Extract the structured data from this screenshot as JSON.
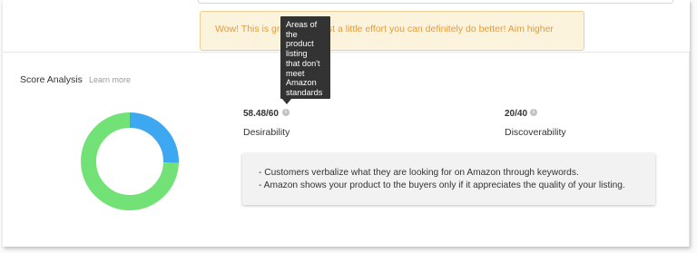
{
  "alert": {
    "text": "Wow! This is great! With just a little effort you can definitely do better! Aim higher"
  },
  "tooltip": {
    "lines": [
      "Areas of",
      "the",
      "product",
      "listing",
      "that don't",
      "meet",
      "Amazon",
      "standards"
    ]
  },
  "score_analysis": {
    "title": "Score Analysis",
    "learn_more": "Learn more"
  },
  "scores": [
    {
      "value": "58.48/60",
      "label": "Desirability"
    },
    {
      "value": "20/40",
      "label": "Discoverability"
    }
  ],
  "donut": {
    "segments": [
      {
        "name": "Desirability",
        "value": 58.48,
        "color": "#72e276"
      },
      {
        "name": "Discoverability",
        "value": 20,
        "color": "#3da7f2"
      }
    ]
  },
  "notes": [
    "- Customers verbalize what they are looking for on Amazon through keywords.",
    "- Amazon shows your product to the buyers only if it appreciates the quality of your listing."
  ],
  "info_icon_glyph": "i"
}
